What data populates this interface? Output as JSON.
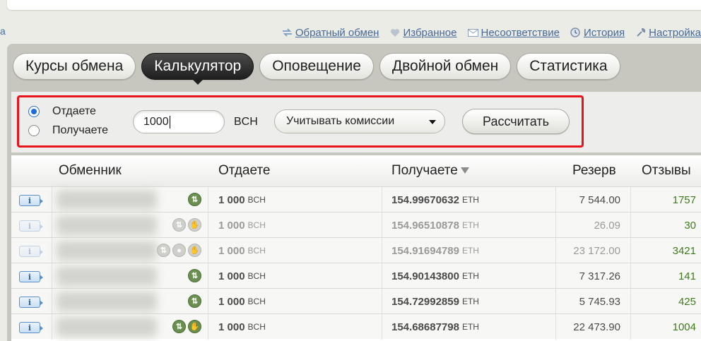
{
  "left_edge_char": "а",
  "top_links": [
    {
      "label": "Обратный обмен",
      "icon": "swap-arrows-icon"
    },
    {
      "label": "Избранное",
      "icon": "heart-icon"
    },
    {
      "label": "Несоответствие",
      "icon": "envelope-icon"
    },
    {
      "label": "История",
      "icon": "history-clock-icon"
    },
    {
      "label": "Настройка",
      "icon": "wrench-icon"
    }
  ],
  "tabs": [
    {
      "label": "Курсы обмена",
      "active": false
    },
    {
      "label": "Калькулятор",
      "active": true
    },
    {
      "label": "Оповещение",
      "active": false
    },
    {
      "label": "Двойной обмен",
      "active": false
    },
    {
      "label": "Статистика",
      "active": false
    }
  ],
  "calculator": {
    "radio_give": "Отдаете",
    "radio_receive": "Получаете",
    "selected": "give",
    "amount": "1000",
    "currency": "BCH",
    "commission_option": "Учитывать комиссии",
    "calculate_button": "Рассчитать"
  },
  "table": {
    "headers": {
      "exchanger": "Обменник",
      "give": "Отдаете",
      "receive": "Получаете",
      "reserve": "Резерв",
      "reviews": "Отзывы"
    },
    "rows": [
      {
        "give": "1 000",
        "give_unit": "BCH",
        "receive": "154.99670632",
        "receive_unit": "ETH",
        "reserve": "7 544.00",
        "reviews": "1757",
        "active": true,
        "features": [
          "manual-exchange-icon"
        ]
      },
      {
        "give": "1 000",
        "give_unit": "BCH",
        "receive": "154.96510878",
        "receive_unit": "ETH",
        "reserve": "26.09",
        "reviews": "30",
        "active": false,
        "features": [
          "manual-exchange-icon",
          "hand-icon"
        ]
      },
      {
        "give": "1 000",
        "give_unit": "BCH",
        "receive": "154.91694789",
        "receive_unit": "ETH",
        "reserve": "23 172.00",
        "reviews": "3421",
        "active": false,
        "features": [
          "manual-exchange-icon",
          "person-icon",
          "hand-icon"
        ]
      },
      {
        "give": "1 000",
        "give_unit": "BCH",
        "receive": "154.90143800",
        "receive_unit": "ETH",
        "reserve": "7 317.26",
        "reviews": "141",
        "active": true,
        "features": [
          "manual-exchange-icon"
        ]
      },
      {
        "give": "1 000",
        "give_unit": "BCH",
        "receive": "154.72992859",
        "receive_unit": "ETH",
        "reserve": "5 745.93",
        "reviews": "425",
        "active": true,
        "features": [
          "manual-exchange-icon"
        ]
      },
      {
        "give": "1 000",
        "give_unit": "BCH",
        "receive": "154.68687798",
        "receive_unit": "ETH",
        "reserve": "22 473.90",
        "reviews": "1004",
        "active": true,
        "features": [
          "manual-exchange-icon",
          "hand-icon"
        ]
      }
    ]
  },
  "colors": {
    "highlight_border": "#e8141c",
    "link": "#46699a",
    "reviews": "#3f7a1e",
    "feature_active": "#6a8f50"
  }
}
